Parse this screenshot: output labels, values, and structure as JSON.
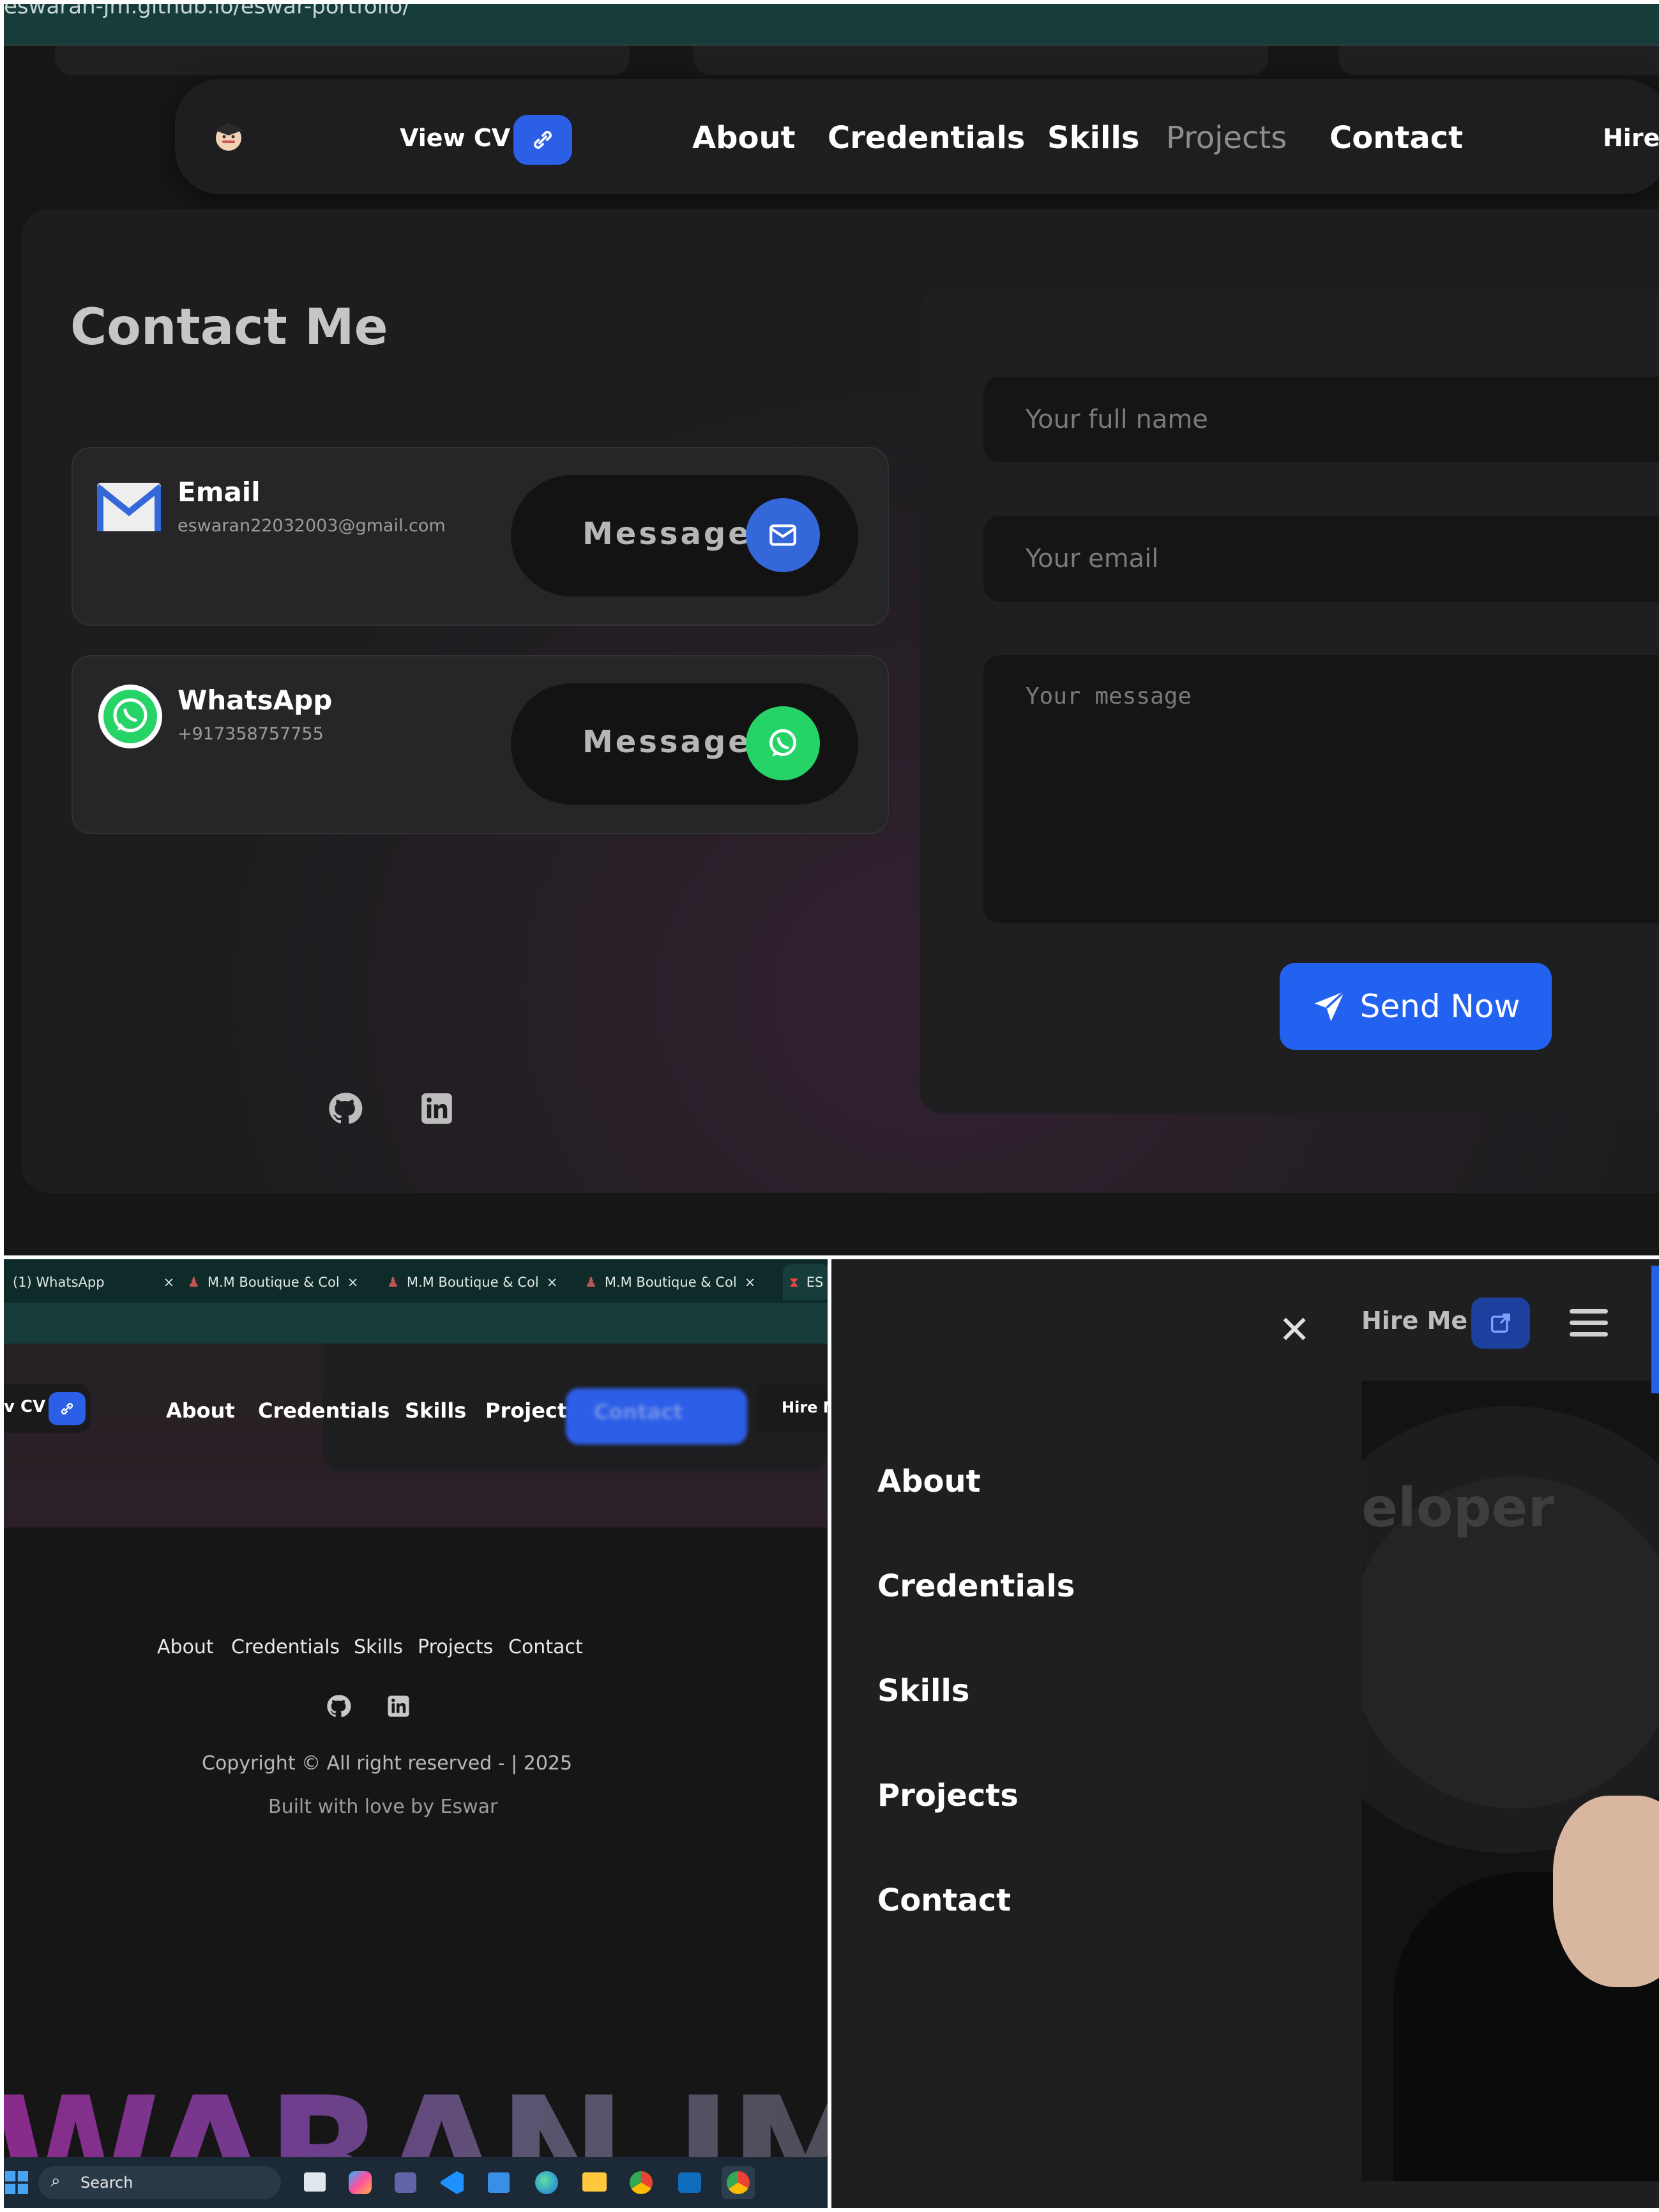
{
  "top": {
    "url": "eswaran-jm.github.io/eswar-portfolio/",
    "nav": {
      "view_cv": "View CV",
      "links": [
        "About",
        "Credentials",
        "Skills",
        "Projects",
        "Contact"
      ],
      "hire": "Hire I"
    },
    "contact_title": "Contact Me",
    "email_card": {
      "title": "Email",
      "value": "eswaran22032003@gmail.com",
      "button": "Message"
    },
    "whatsapp_card": {
      "title": "WhatsApp",
      "value": "+917358757755",
      "button": "Message"
    },
    "form": {
      "name_placeholder": "Your full name",
      "email_placeholder": "Your email",
      "message_placeholder": "Your message",
      "send_label": "Send Now"
    },
    "social": [
      "github-icon",
      "linkedin-icon"
    ]
  },
  "bottom_left": {
    "tabs": [
      {
        "label": "(1) WhatsApp",
        "close": "×"
      },
      {
        "label": "M.M Boutique & Col",
        "close": "×"
      },
      {
        "label": "M.M Boutique & Col",
        "close": "×"
      },
      {
        "label": "M.M Boutique & Col",
        "close": "×"
      },
      {
        "label": "ES",
        "close": ""
      }
    ],
    "nav": {
      "view_cv": "v CV",
      "links": [
        "About",
        "Credentials",
        "Skills",
        "Projects",
        "Contact"
      ],
      "hire": "Hire M"
    },
    "footer_links": [
      "About",
      "Credentials",
      "Skills",
      "Projects",
      "Contact"
    ],
    "copyright": "Copyright © All right reserved - | 2025",
    "built": "Built with love by Eswar",
    "big_name": "WARAN JM",
    "search": "Search"
  },
  "bottom_right": {
    "close": "✕",
    "hire": "Hire Me",
    "bg_text": "eloper",
    "menu": [
      "About",
      "Credentials",
      "Skills",
      "Projects",
      "Contact"
    ]
  },
  "colors": {
    "accent_blue": "#2a5fe6",
    "whatsapp_green": "#25d366",
    "email_blue": "#3468d9"
  }
}
